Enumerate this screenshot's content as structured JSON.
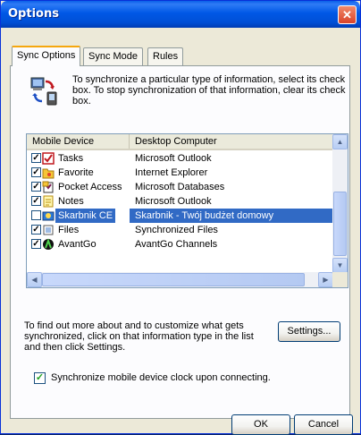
{
  "window": {
    "title": "Options",
    "close_glyph": "✕"
  },
  "tabs": [
    {
      "label": "Sync Options",
      "active": true
    },
    {
      "label": "Sync Mode",
      "active": false
    },
    {
      "label": "Rules",
      "active": false
    }
  ],
  "info_text": "To synchronize a particular type of information, select its check box. To stop synchronization of that information, clear its check box.",
  "list": {
    "columns": [
      "Mobile Device",
      "Desktop Computer"
    ],
    "rows": [
      {
        "device": "Tasks",
        "desktop": "Microsoft Outlook",
        "checked": true,
        "icon": "tasks-icon",
        "selected": false
      },
      {
        "device": "Favorite",
        "desktop": "Internet Explorer",
        "checked": true,
        "icon": "favorite-folder-icon",
        "selected": false
      },
      {
        "device": "Pocket Access",
        "desktop": "Microsoft Databases",
        "checked": true,
        "icon": "pocket-access-icon",
        "selected": false
      },
      {
        "device": "Notes",
        "desktop": "Microsoft Outlook",
        "checked": true,
        "icon": "notes-icon",
        "selected": false
      },
      {
        "device": "Skarbnik CE",
        "desktop": "Skarbnik - Twój budżet domowy",
        "checked": false,
        "icon": "skarbnik-icon",
        "selected": true
      },
      {
        "device": "Files",
        "desktop": "Synchronized Files",
        "checked": true,
        "icon": "files-icon",
        "selected": false
      },
      {
        "device": "AvantGo",
        "desktop": "AvantGo Channels",
        "checked": true,
        "icon": "avantgo-icon",
        "selected": false
      }
    ]
  },
  "description": "To find out more about and to customize what gets synchronized, click on that information type in the list and then click Settings.",
  "settings_label": "Settings...",
  "clock_sync": {
    "label": "Synchronize mobile device clock upon connecting.",
    "checked": true
  },
  "footer": {
    "ok_label": "OK",
    "cancel_label": "Cancel"
  },
  "colors": {
    "selection": "#316ac5",
    "titlebar": "#0058e6",
    "dialog_bg": "#ece9d8"
  }
}
